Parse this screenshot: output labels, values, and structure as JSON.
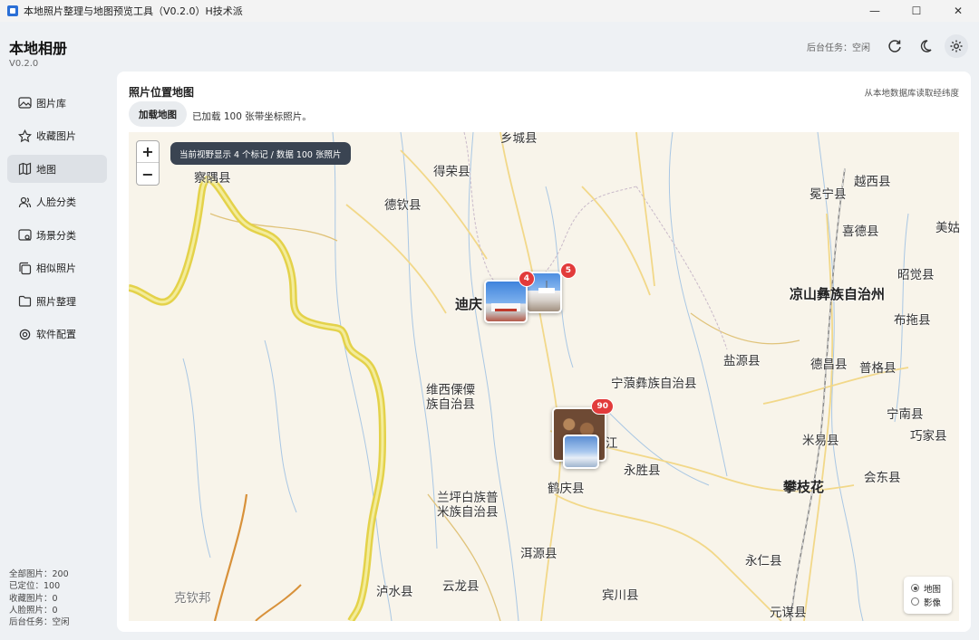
{
  "window": {
    "title": "本地照片整理与地图预览工具（V0.2.0）H技术派",
    "minimize": "—",
    "maximize": "☐",
    "close": "✕"
  },
  "app": {
    "name": "本地相册",
    "version": "V0.2.0"
  },
  "header": {
    "status": "后台任务：空闲",
    "icons": [
      "refresh-icon",
      "moon-icon",
      "gear-icon"
    ]
  },
  "sidebar": {
    "items": [
      {
        "label": "图片库",
        "icon": "image-icon",
        "active": false
      },
      {
        "label": "收藏图片",
        "icon": "star-icon",
        "active": false
      },
      {
        "label": "地图",
        "icon": "map-icon",
        "active": true
      },
      {
        "label": "人脸分类",
        "icon": "people-icon",
        "active": false
      },
      {
        "label": "场景分类",
        "icon": "scene-icon",
        "active": false
      },
      {
        "label": "相似照片",
        "icon": "copy-icon",
        "active": false
      },
      {
        "label": "照片整理",
        "icon": "folder-icon",
        "active": false
      },
      {
        "label": "软件配置",
        "icon": "gear-icon",
        "active": false
      }
    ]
  },
  "stats": {
    "total": "全部图片：200",
    "located": "已定位：100",
    "favorites": "收藏图片：0",
    "faces": "人脸照片：0",
    "task": "后台任务：空闲"
  },
  "panel": {
    "title": "照片位置地图",
    "note": "从本地数据库读取经纬度",
    "load_button": "加载地图",
    "load_message": "已加载 100 张带坐标照片。"
  },
  "map": {
    "zoom_in": "+",
    "zoom_out": "−",
    "tooltip": "当前视野显示 4 个标记 / 数据 100 张照片",
    "labels": {
      "xiangcheng": "乡城县",
      "derong": "得荣县",
      "chayu": "察隅县",
      "deqin": "德钦县",
      "diqing": "迪庆",
      "weixi1": "维西傈僳",
      "weixi2": "族自治县",
      "ninglang": "宁蒗彝族自治县",
      "yongsheng": "永胜县",
      "heqing": "鹤庆县",
      "lanping1": "兰坪白族普",
      "lanping2": "米族自治县",
      "eryuan": "洱源县",
      "lushui": "泸水县",
      "yunlong": "云龙县",
      "binchuan": "宾川县",
      "gongshan": "克钦邦",
      "mianning": "冕宁县",
      "yuexi": "越西县",
      "xide": "喜德县",
      "meigu": "美姑",
      "zhaojue": "昭觉县",
      "liangshan": "凉山彝族自治州",
      "butuo": "布拖县",
      "yanyuan": "盐源县",
      "dechang": "德昌县",
      "puge": "普格县",
      "ningnan": "宁南县",
      "miyi": "米易县",
      "qiaojia": "巧家县",
      "panzhihua": "攀枝花",
      "huidong": "会东县",
      "yongren": "永仁县",
      "yuanmou": "元谋县",
      "lijiang": "江"
    },
    "clusters": [
      {
        "count": "4",
        "place": "迪庆"
      },
      {
        "count": "5",
        "place": "迪庆"
      },
      {
        "count": "90",
        "place": "丽江"
      }
    ],
    "layers": {
      "map": "地图",
      "satellite": "影像",
      "selected": "map"
    }
  },
  "colors": {
    "accent": "#e23b3b",
    "active_nav": "#dde1e6",
    "map_bg": "#f8f4ea",
    "border_road": "#e7d84a"
  }
}
